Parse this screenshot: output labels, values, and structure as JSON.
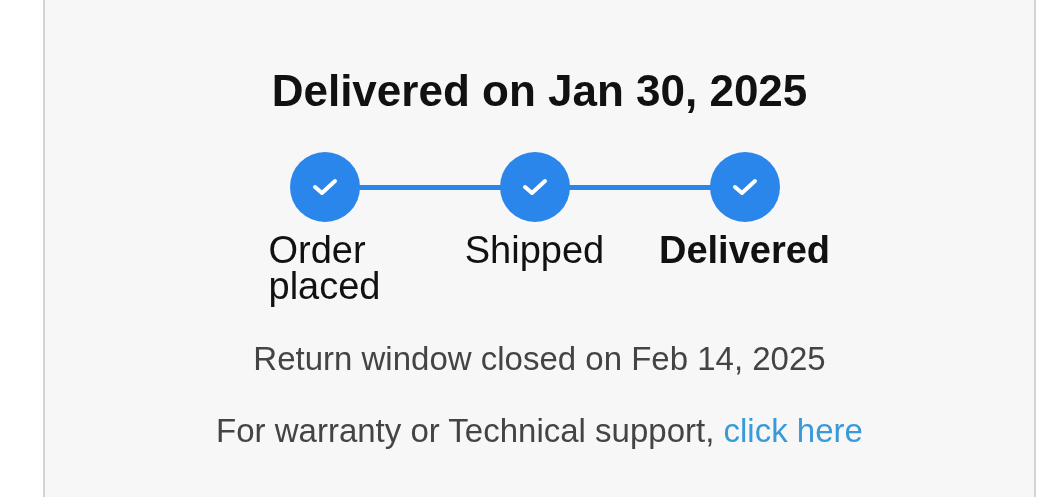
{
  "title": "Delivered on Jan 30, 2025",
  "steps": [
    {
      "label": "Order placed",
      "completed": true,
      "selected": false
    },
    {
      "label": "Shipped",
      "completed": true,
      "selected": false
    },
    {
      "label": "Delivered",
      "completed": true,
      "selected": true
    }
  ],
  "return_note": "Return window closed on Feb 14, 2025",
  "support": {
    "text": "For warranty or Technical support,",
    "link": "click here"
  }
}
